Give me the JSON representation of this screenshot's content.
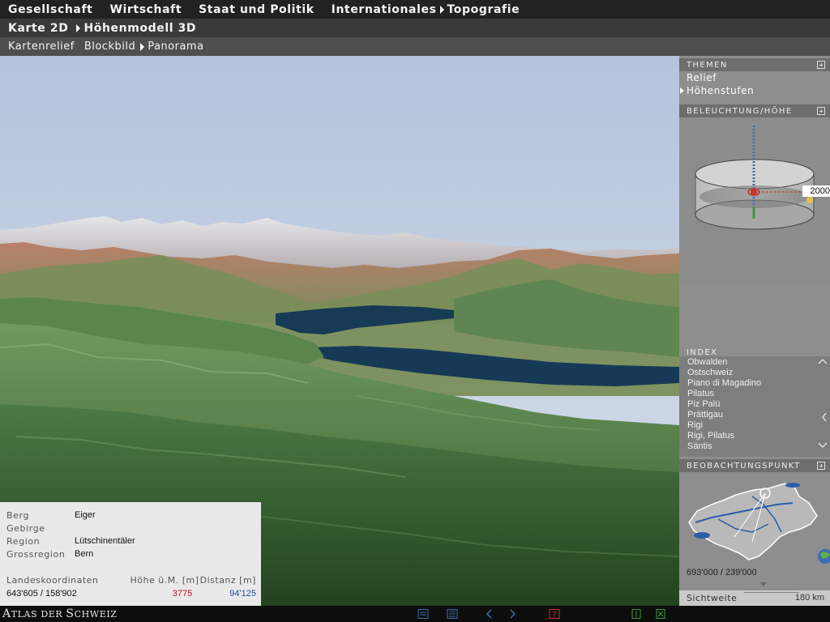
{
  "menu_primary": [
    {
      "label": "Gesellschaft",
      "arrow": false
    },
    {
      "label": "Wirtschaft",
      "arrow": false
    },
    {
      "label": "Staat und Politik",
      "arrow": false
    },
    {
      "label": "Internationales",
      "arrow": false
    },
    {
      "label": "Topografie",
      "arrow": true
    }
  ],
  "menu_secondary": [
    {
      "label": "Karte 2D",
      "arrow": false
    },
    {
      "label": "Höhenmodell 3D",
      "arrow": true
    }
  ],
  "menu_tertiary": [
    {
      "label": "Kartenrelief",
      "arrow": false
    },
    {
      "label": "Blockbild",
      "arrow": false
    },
    {
      "label": "Panorama",
      "arrow": true
    }
  ],
  "info": {
    "berg_label": "Berg",
    "berg_value": "Eiger",
    "gebirge_label": "Gebirge",
    "gebirge_value": "",
    "region_label": "Region",
    "region_value": "Lütschinentäler",
    "grossregion_label": "Grossregion",
    "grossregion_value": "Bern",
    "coord_label": "Landeskoordinaten",
    "height_label": "Höhe ü.M. [m]",
    "dist_label": "Distanz [m]",
    "coord_value": "643'605 / 158'902",
    "height_value": "3775",
    "dist_value": "94'125",
    "height_color": "#c0141c",
    "dist_color": "#1d4fa0"
  },
  "panel": {
    "themen_title": "THEMEN",
    "themen_items": [
      "Relief",
      "Höhenstufen"
    ],
    "themen_active_index": 1,
    "beleuchtung_title": "BELEUCHTUNG/HÖHE",
    "height_readout": "2000",
    "index_title": "INDEX",
    "index_items": [
      "Obwalden",
      "Ostschweiz",
      "Piano di Magadino",
      "Pilatus",
      "Piz Palü",
      "Prättigau",
      "Rigi",
      "Rigi, Pilatus",
      "Säntis"
    ],
    "beobachtung_title": "BEOBACHTUNGSPUNKT",
    "beobachtung_coords": "693'000 / 239'000",
    "sichtweite_label": "Sichtweite",
    "sichtweite_value": "180 km"
  },
  "footer": {
    "brand_first_A": "A",
    "brand_first_rest": "TLAS DER ",
    "brand_second_S": "S",
    "brand_second_rest": "CHWEIZ"
  },
  "colors": {
    "sky_top": "#b6c6de",
    "lake": "#173a55",
    "accent_red": "#c0141c",
    "accent_blue": "#1d4fa0",
    "icon_blue": "#3d6fb0",
    "icon_red": "#c2352a",
    "icon_green": "#3d9a3d"
  },
  "icons": [
    "document-icon",
    "list-icon",
    "chevron-left-icon",
    "chevron-right-icon",
    "help-icon",
    "exit-icon",
    "close-icon",
    "globe-icon"
  ]
}
